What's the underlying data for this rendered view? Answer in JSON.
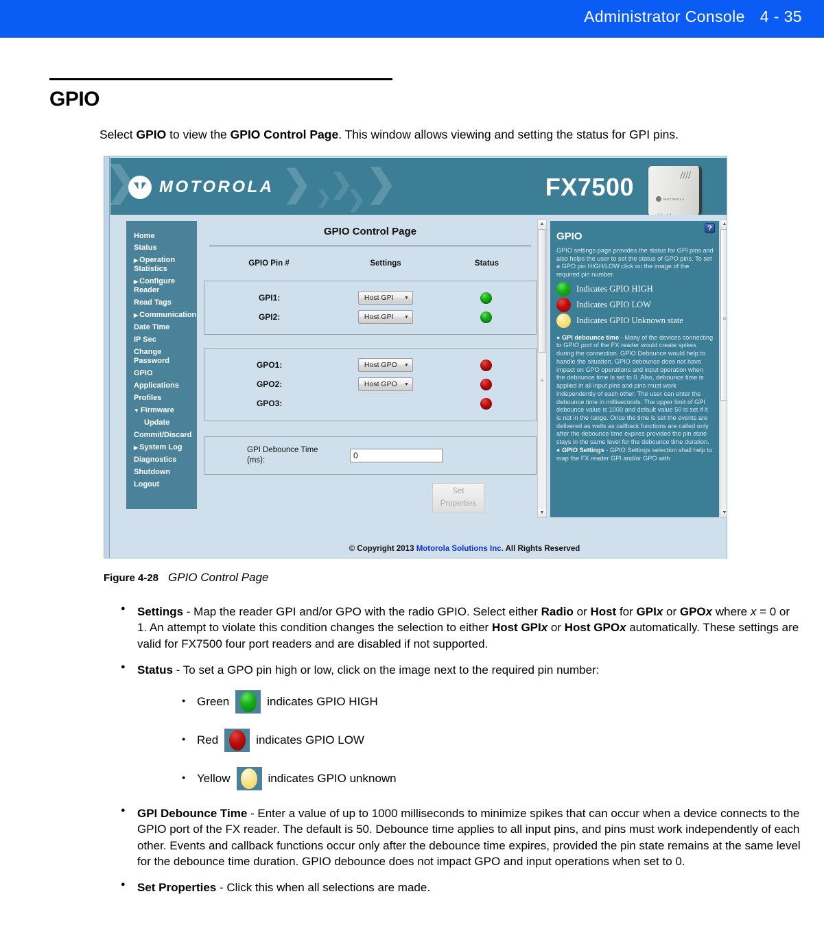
{
  "page_header": {
    "title": "Administrator Console",
    "page_number": "4 - 35"
  },
  "section": {
    "heading": "GPIO",
    "intro_prefix": "Select ",
    "intro_bold_1": "GPIO",
    "intro_mid": " to view the ",
    "intro_bold_2": "GPIO Control Page",
    "intro_suffix": ". This window allows viewing and setting the status for GPI pins."
  },
  "screenshot": {
    "brand": {
      "wordmark": "MOTOROLA",
      "product": "FX7500",
      "device_logo_text": "MOTOROLA"
    },
    "sidebar": {
      "items": [
        {
          "label": "Home",
          "arrow": "",
          "sub": false
        },
        {
          "label": "Status",
          "arrow": "",
          "sub": false
        },
        {
          "label": "Operation Statistics",
          "arrow": "▶",
          "sub": false
        },
        {
          "label": "Configure Reader",
          "arrow": "▶",
          "sub": false
        },
        {
          "label": "Read Tags",
          "arrow": "",
          "sub": false
        },
        {
          "label": "Communication",
          "arrow": "▶",
          "sub": false
        },
        {
          "label": "Date Time",
          "arrow": "",
          "sub": false
        },
        {
          "label": "IP Sec",
          "arrow": "",
          "sub": false
        },
        {
          "label": "Change Password",
          "arrow": "",
          "sub": false
        },
        {
          "label": "GPIO",
          "arrow": "",
          "sub": false
        },
        {
          "label": "Applications",
          "arrow": "",
          "sub": false
        },
        {
          "label": "Profiles",
          "arrow": "",
          "sub": false
        },
        {
          "label": "Firmware",
          "arrow": "▼",
          "sub": false
        },
        {
          "label": "Update",
          "arrow": "",
          "sub": true
        },
        {
          "label": "Commit/Discard",
          "arrow": "",
          "sub": false
        },
        {
          "label": "System Log",
          "arrow": "▶",
          "sub": false
        },
        {
          "label": "Diagnostics",
          "arrow": "",
          "sub": false
        },
        {
          "label": "Shutdown",
          "arrow": "",
          "sub": false
        },
        {
          "label": "Logout",
          "arrow": "",
          "sub": false
        }
      ]
    },
    "main": {
      "title": "GPIO Control Page",
      "columns": [
        "GPIO Pin #",
        "Settings",
        "Status"
      ],
      "gpi_rows": [
        {
          "pin": "GPI1:",
          "setting": "Host GPI",
          "status": "green"
        },
        {
          "pin": "GPI2:",
          "setting": "Host GPI",
          "status": "green"
        }
      ],
      "gpo_rows": [
        {
          "pin": "GPO1:",
          "setting": "Host GPO",
          "status": "red"
        },
        {
          "pin": "GPO2:",
          "setting": "Host GPO",
          "status": "red"
        },
        {
          "pin": "GPO3:",
          "setting": "",
          "status": "red"
        }
      ],
      "debounce": {
        "label_line1": "GPI Debounce Time",
        "label_line2": "(ms):",
        "value": "0"
      },
      "set_properties": {
        "line1": "Set",
        "line2": "Properties"
      },
      "copyright": {
        "prefix": "© Copyright 2013 ",
        "link": "Motorola Solutions Inc.",
        "suffix": " All Rights Reserved"
      }
    },
    "help": {
      "badge": "?",
      "title": "GPIO",
      "intro": "GPIO settings page provides the status for GPI pins and also helps the user to set the status of GPO pins. To set a GPO pin HIGH/LOW click on the image of the required pin number.",
      "legend": [
        {
          "color": "green",
          "text": "Indicates GPIO HIGH"
        },
        {
          "color": "red",
          "text": "Indicates GPIO LOW"
        },
        {
          "color": "yellow",
          "text": "Indicates GPIO Unknown state"
        }
      ],
      "bullet1_title": "GPI debounce time",
      "bullet1_text": " - Many of the devices connecting to GPIO port of the FX reader would create spikes during the connection. GPIO Debounce would help to handle the situation. GPIO debounce does not have impact on GPO operations and input operation when the debounce time is set to 0. Also, debounce time is applied in all input pins and pins must work independently of each other. The user can enter the debounce time in milliseconds. The upper limit of GPI debounce value is 1000 and default value 50 is set if it is not in the range. Once the time is set the events are delivered as wells as callback functions are called only after the debounce time expires provided the pin state stays in the same level for the debounce time duration.",
      "bullet2_title": "GPIO Settings",
      "bullet2_text": " - GPIO Settings selection shall help to map the FX reader GPI and/or GPO with"
    }
  },
  "figure": {
    "number": "Figure 4-28",
    "caption": "GPIO Control Page"
  },
  "doc_bullets": {
    "settings": {
      "title": "Settings",
      "text": " - Map the reader GPI and/or GPO with the radio GPIO. Select either <b>Radio</b> or <b>Host</b> for <b>GPI<i>x</i></b> or <b>GPO<i>x</i></b> where <i>x</i> = 0 or 1. An attempt to violate this condition changes the selection to either <b>Host GPI<i>x</i></b> or <b>Host GPO<i>x</i></b> automatically. These settings are valid for FX7500 four port readers and are disabled if not supported."
    },
    "status": {
      "title": "Status",
      "text": " - To set a GPO pin high or low, click on the image next to the required pin number:"
    },
    "status_sub": [
      {
        "color": "green",
        "pre": "Green",
        "post": "indicates GPIO HIGH"
      },
      {
        "color": "red",
        "pre": "Red",
        "post": "indicates GPIO LOW"
      },
      {
        "color": "yellow",
        "pre": "Yellow",
        "post": "indicates GPIO unknown"
      }
    ],
    "debounce": {
      "title": "GPI Debounce Time",
      "text": " - Enter a value of up to 1000 milliseconds to minimize spikes that can occur when a device connects to the GPIO port of the FX reader. The default is 50. Debounce time applies to all input pins, and pins must work independently of each other. Events and callback functions occur only after the debounce time expires, provided the pin state remains at the same level for the debounce time duration. GPIO debounce does not impact GPO and input operations when set to 0."
    },
    "setprops": {
      "title": "Set Properties",
      "text": " - Click this when all selections are made."
    }
  },
  "colors": {
    "band_blue": "#0B5CF5",
    "teal": "#3b7e96",
    "sidebar_teal": "#4a8399",
    "panel_blue": "#cfe0ec",
    "link_blue": "#1432d1"
  }
}
